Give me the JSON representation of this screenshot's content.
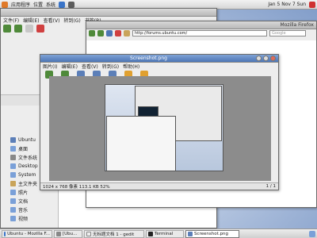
{
  "top_panel": {
    "menus": [
      "应用程序",
      "位置",
      "系统"
    ],
    "clock": "Jan 5 Nov 7 Sun"
  },
  "file_window": {
    "title": "",
    "menus": [
      "文件(F)",
      "编辑(E)",
      "查看(V)",
      "转到(G)",
      "书签(B)",
      "帮助(H)"
    ],
    "sidebar": [
      "Ubuntu",
      "桌面",
      "文件系统",
      "Desktop",
      "System",
      "主文件夹",
      "照片",
      "文档",
      "音乐",
      "视频"
    ]
  },
  "browser_window": {
    "title": "Mozilla Firefox",
    "url": "http://forums.ubuntu.com/",
    "search_placeholder": "Google"
  },
  "image_window": {
    "title": "Screenshot.png",
    "menus": [
      "图片(I)",
      "编辑(E)",
      "查看(V)",
      "转到(G)",
      "帮助(H)"
    ],
    "status_left": "1024 x 768 像素  113.1 KB  52%",
    "status_right": "1 / 1"
  },
  "taskbar": {
    "items": [
      {
        "label": "Ubuntu - Mozilla F..."
      },
      {
        "label": "[Ubu..."
      },
      {
        "label": "无标题文档 1 - gedit"
      },
      {
        "label": "Terminal"
      },
      {
        "label": "Screenshot.png"
      }
    ]
  },
  "colors": {
    "accent": "#4d76b5",
    "panel": "#d6d6d6"
  }
}
